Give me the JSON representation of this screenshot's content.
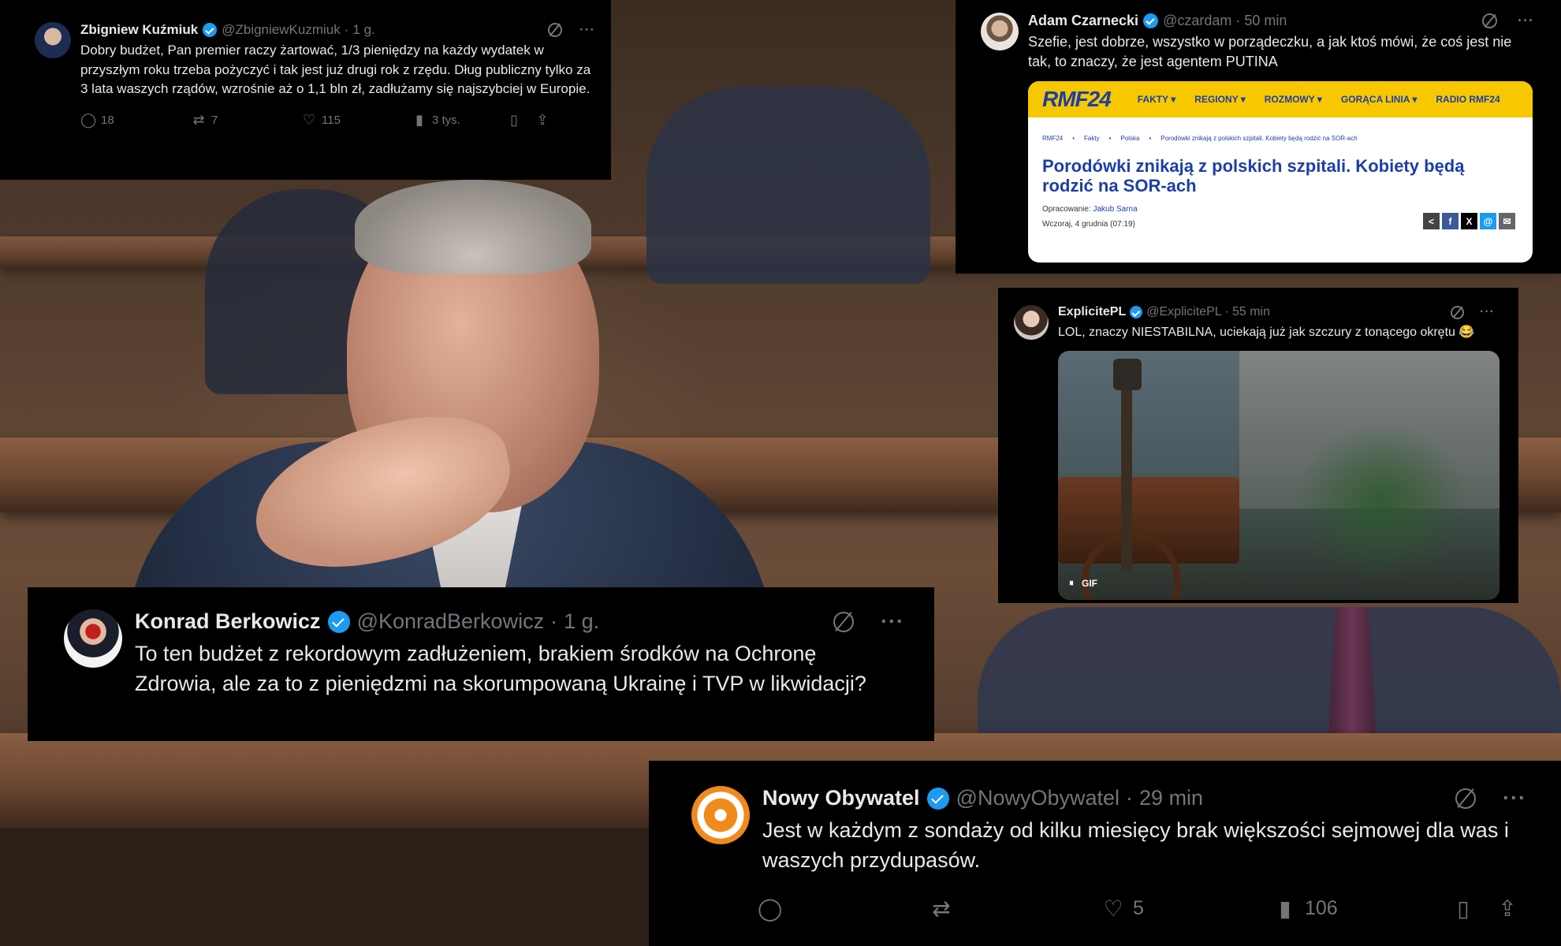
{
  "tweets": [
    {
      "name": "Zbigniew Kuźmiuk",
      "handle": "@ZbigniewKuzmiuk",
      "sep": "·",
      "time": "1 g.",
      "text": "Dobry budżet, Pan premier raczy żartować, 1/3 pieniędzy na każdy wydatek w przyszłym roku trzeba pożyczyć i tak jest już drugi rok z rzędu. Dług publiczny tylko za 3 lata waszych rządów, wzrośnie aż o 1,1 bln zł, zadłużamy się najszybciej w Europie.",
      "replies": "18",
      "reposts": "7",
      "likes": "115",
      "views": "3 tys."
    },
    {
      "name": "Adam Czarnecki",
      "handle": "@czardam",
      "sep": "·",
      "time": "50 min",
      "text": "Szefie, jest dobrze, wszystko w porządeczku, a jak ktoś mówi, że coś jest nie tak, to znaczy, że jest agentem PUTINA",
      "article": {
        "logo": "RMF24",
        "nav": [
          "FAKTY ▾",
          "REGIONY ▾",
          "ROZMOWY ▾",
          "GORĄCA LINIA ▾",
          "RADIO RMF24"
        ],
        "crumbs": [
          "RMF24",
          "•",
          "Fakty",
          "•",
          "Polska",
          "•",
          "Porodówki znikają z polskich szpitali. Kobiety będą rodzić na SOR-ach"
        ],
        "title": "Porodówki znikają z polskich szpitali. Kobiety będą rodzić na SOR-ach",
        "author_label": "Opracowanie:",
        "author": "Jakub Sarna",
        "date": "Wczoraj, 4 grudnia (07:19)"
      }
    },
    {
      "name": "ExplicitePL",
      "handle": "@ExplicitePL",
      "sep": "·",
      "time": "55 min",
      "text": "LOL, znaczy NIESTABILNA, uciekają już jak szczury z tonącego okrętu 😂",
      "gif_label": "GIF"
    },
    {
      "name": "Konrad Berkowicz",
      "handle": "@KonradBerkowicz",
      "sep": "·",
      "time": "1 g.",
      "text": "To ten budżet z rekordowym zadłużeniem, brakiem środków na Ochronę Zdrowia, ale za to z pieniędzmi na skorumpowaną Ukrainę i TVP w likwidacji?"
    },
    {
      "name": "Nowy Obywatel",
      "handle": "@NowyObywatel",
      "sep": "·",
      "time": "29 min",
      "text": "Jest w każdym z sondaży od kilku miesięcy brak większości sejmowej dla was i waszych przydupasów.",
      "likes": "5",
      "views": "106"
    }
  ],
  "icons": {
    "more": "···",
    "reply": "◯",
    "repost": "⇄",
    "like": "♡",
    "views": "▮",
    "bookmark": "▯",
    "share": "⇪",
    "pause": "⏸"
  },
  "colors": {
    "verified": "#1d9bf0",
    "card_bg": "#000000",
    "text": "#e7e9ea",
    "muted": "#71767b",
    "rmf_yellow": "#f7c800",
    "rmf_blue": "#1d3ea8"
  }
}
